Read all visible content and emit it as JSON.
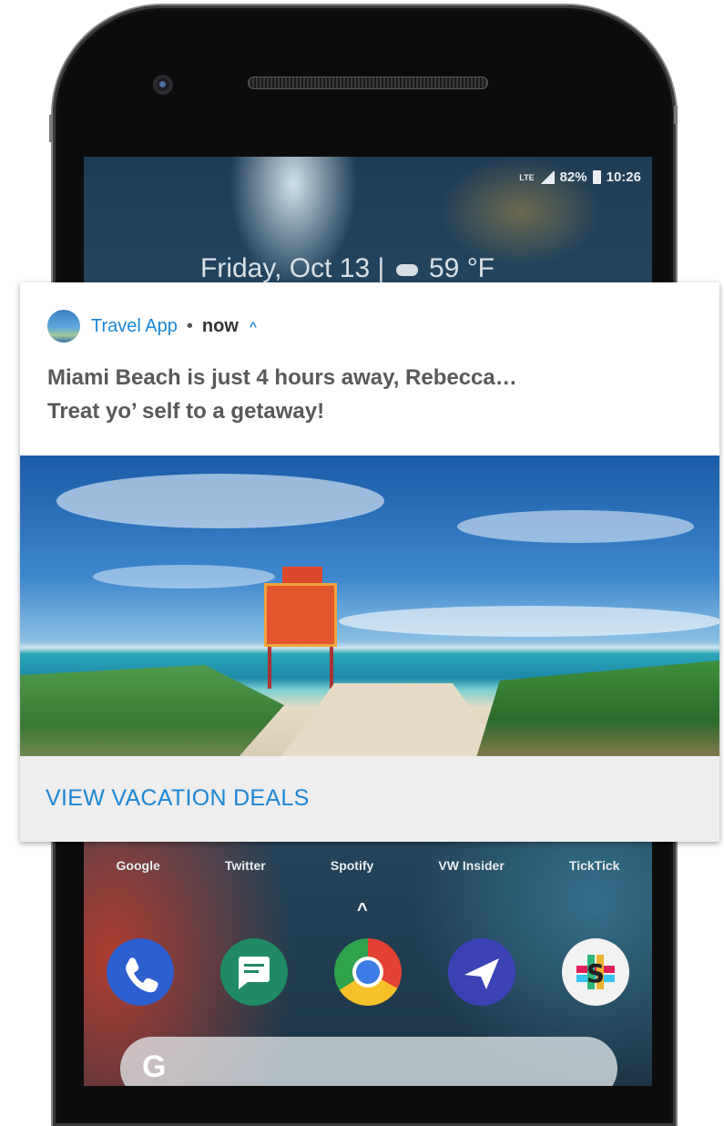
{
  "status_bar": {
    "signal": "LTE",
    "battery": "82%",
    "time": "10:26"
  },
  "lockscreen": {
    "date": "Friday, Oct 13 |",
    "weather_icon": "cloud-icon",
    "temperature": "59 °F"
  },
  "notification": {
    "app_name": "Travel App",
    "separator": "•",
    "time": "now",
    "expand_icon": "^",
    "message_line1": "Miami Beach is just 4 hours away, Rebecca…",
    "message_line2": "Treat yo’ self to a getaway!",
    "image": "miami-beach-lifeguard-tower",
    "action_label": "VIEW VACATION DEALS",
    "accent_color": "#1c86d6"
  },
  "home": {
    "dock_labels": [
      "Google",
      "Twitter",
      "Spotify",
      "VW Insider",
      "TickTick"
    ],
    "up_chevron": "^",
    "apps": [
      {
        "name": "phone-icon",
        "color": "#2d5fcf"
      },
      {
        "name": "messages-icon",
        "color": "#1f8a63"
      },
      {
        "name": "chrome-icon",
        "color": "#e34133"
      },
      {
        "name": "send-icon",
        "color": "#3b42b6"
      },
      {
        "name": "slack-icon",
        "color": "#f2f2f2"
      }
    ],
    "search_logo": "G"
  }
}
